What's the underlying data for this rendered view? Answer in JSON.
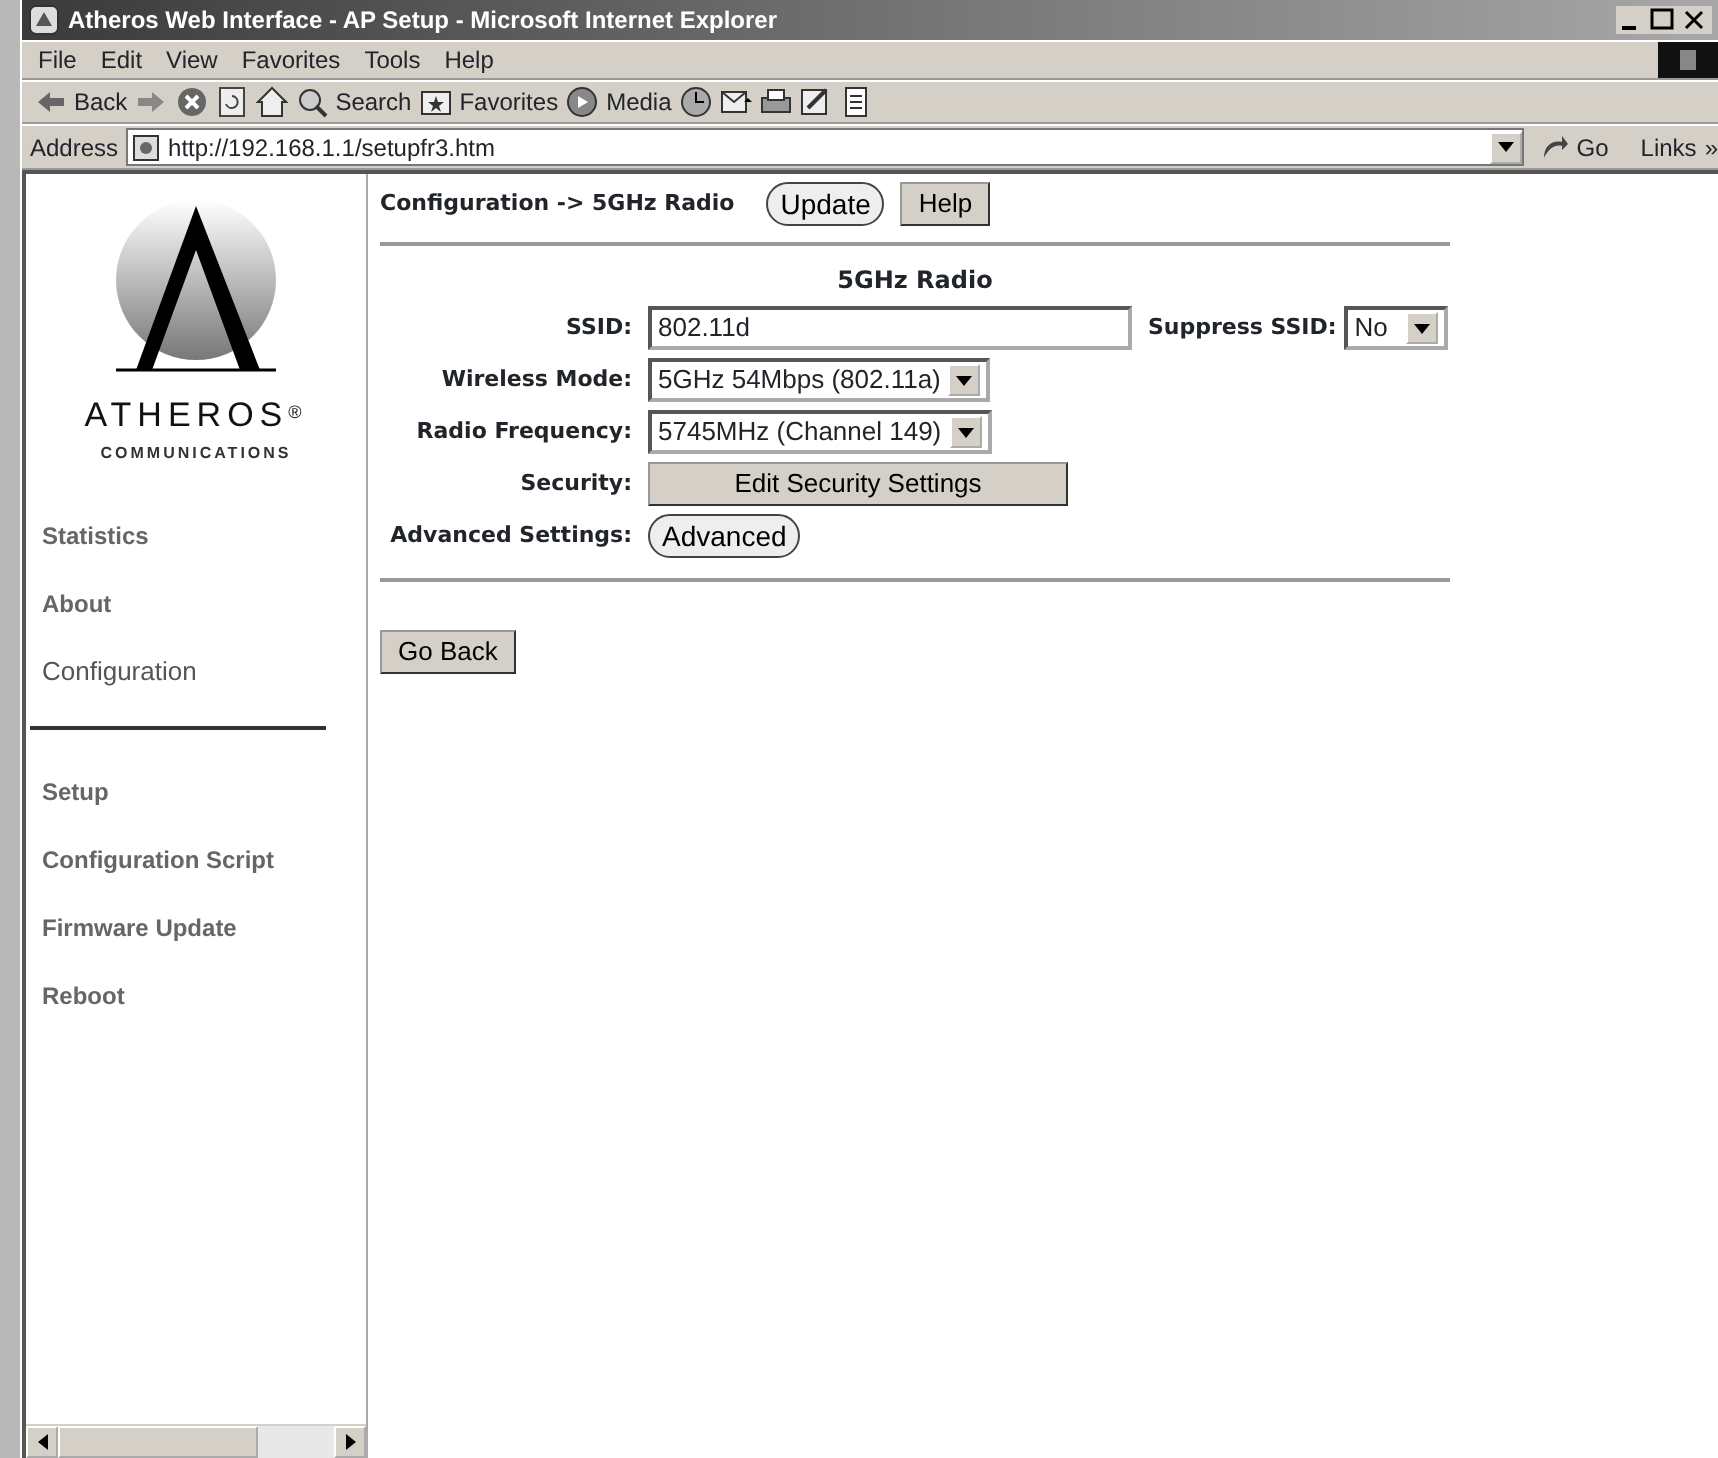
{
  "window": {
    "title": "Atheros Web Interface - AP Setup - Microsoft Internet Explorer"
  },
  "menu": [
    "File",
    "Edit",
    "View",
    "Favorites",
    "Tools",
    "Help"
  ],
  "toolbar": [
    {
      "kind": "back",
      "label": "Back"
    },
    {
      "kind": "forward"
    },
    {
      "kind": "stop"
    },
    {
      "kind": "refresh"
    },
    {
      "kind": "home"
    },
    {
      "kind": "search",
      "label": "Search"
    },
    {
      "kind": "favorites",
      "label": "Favorites"
    },
    {
      "kind": "media",
      "label": "Media"
    },
    {
      "kind": "history"
    },
    {
      "kind": "mail"
    },
    {
      "kind": "print"
    },
    {
      "kind": "edit"
    },
    {
      "kind": "discuss"
    }
  ],
  "address": {
    "label": "Address",
    "url": "http://192.168.1.1/setupfr3.htm",
    "go": "Go",
    "links": "Links",
    "more": "»"
  },
  "sidebar": {
    "logo": {
      "name": "ATHEROS",
      "mark": "®",
      "tagline": "COMMUNICATIONS"
    },
    "groups": [
      [
        {
          "label": "Statistics",
          "selected": false
        },
        {
          "label": "About",
          "selected": false
        },
        {
          "label": "Configuration",
          "selected": true
        }
      ],
      [
        {
          "label": "Setup",
          "selected": false
        },
        {
          "label": "Configuration Script",
          "selected": false
        },
        {
          "label": "Firmware Update",
          "selected": false
        },
        {
          "label": "Reboot",
          "selected": false
        }
      ]
    ]
  },
  "breadcrumb": "Configuration -> 5GHz Radio",
  "header_buttons": [
    {
      "kind": "pill",
      "label": "Update"
    },
    {
      "kind": "square",
      "label": "Help"
    }
  ],
  "form": {
    "title": "5GHz Radio",
    "rows": [
      {
        "label": "SSID:",
        "kind": "text",
        "value": "802.11d",
        "extra": {
          "label": "Suppress SSID:",
          "value": "No"
        }
      },
      {
        "label": "Wireless Mode:",
        "kind": "select",
        "value": "5GHz 54Mbps (802.11a)"
      },
      {
        "label": "Radio Frequency:",
        "kind": "select",
        "value": "5745MHz (Channel 149)"
      },
      {
        "label": "Security:",
        "kind": "square",
        "value": "Edit Security Settings"
      },
      {
        "label": "Advanced Settings:",
        "kind": "pill",
        "value": "Advanced"
      }
    ]
  },
  "back_button": "Go Back"
}
